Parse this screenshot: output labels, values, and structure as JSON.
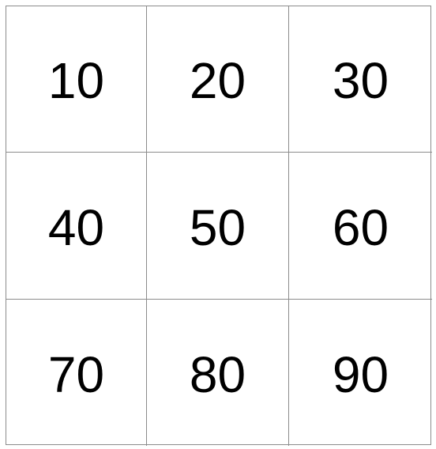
{
  "grid": {
    "rows": [
      [
        "10",
        "20",
        "30"
      ],
      [
        "40",
        "50",
        "60"
      ],
      [
        "70",
        "80",
        "90"
      ]
    ]
  },
  "colors": {
    "background": "#ffffff",
    "grid_line": "#8c8c8c",
    "text": "#000000"
  }
}
